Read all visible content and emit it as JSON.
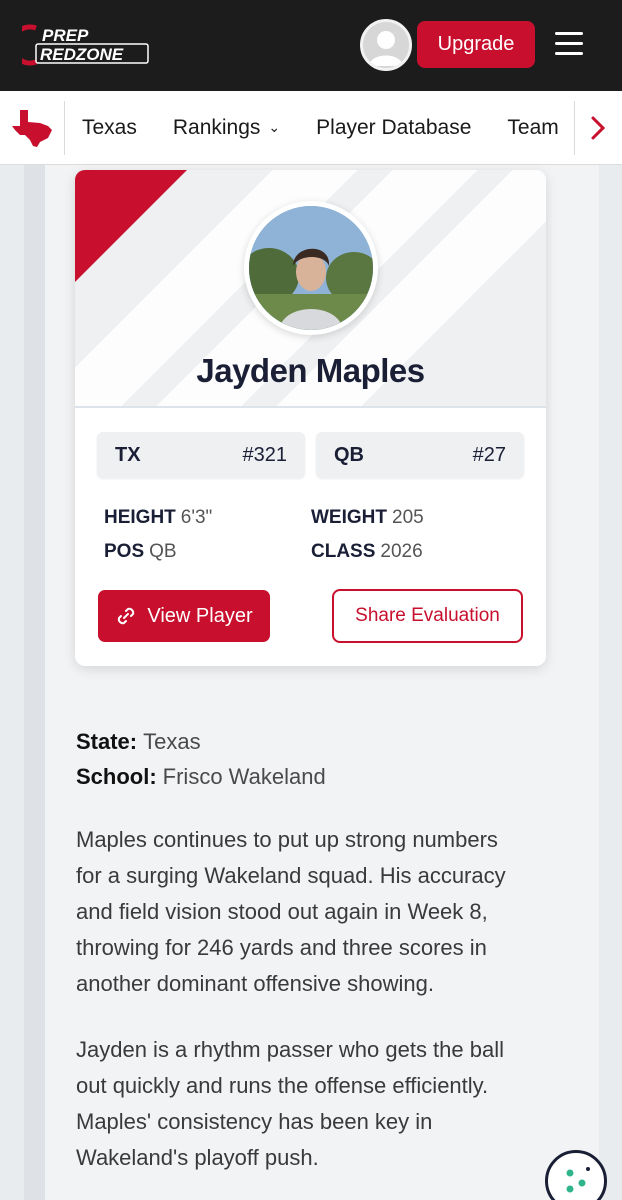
{
  "header": {
    "logo_line1": "PREP",
    "logo_line2": "REDZONE",
    "upgrade_label": "Upgrade",
    "brand_color": "#c8102e",
    "icons": [
      "user-avatar-icon",
      "hamburger-menu-icon"
    ]
  },
  "nav": {
    "state_icon": "texas-map-icon",
    "items": [
      {
        "label": "Texas"
      },
      {
        "label": "Rankings",
        "has_dropdown": true
      },
      {
        "label": "Player Database"
      },
      {
        "label": "Team"
      }
    ],
    "next_icon": "chevron-right-icon"
  },
  "card": {
    "player_name": "Jayden Maples",
    "pills": [
      {
        "key": "TX",
        "value": "#321"
      },
      {
        "key": "QB",
        "value": "#27"
      }
    ],
    "attributes": {
      "height_label": "HEIGHT",
      "height_value": "6'3\"",
      "weight_label": "WEIGHT",
      "weight_value": "205",
      "pos_label": "POS",
      "pos_value": "QB",
      "class_label": "CLASS",
      "class_value": "2026"
    },
    "view_player_label": "View Player",
    "share_label": "Share Evaluation"
  },
  "article": {
    "state_label": "State:",
    "state_value": "Texas",
    "school_label": "School:",
    "school_value": "Frisco Wakeland",
    "para1_lines": [
      "Maples continues to put up strong numbers",
      "for a surging Wakeland squad. His accuracy",
      "and field vision stood out again in Week 8,",
      "throwing for 246 yards and three scores in",
      "another dominant offensive showing."
    ],
    "para2_lines": [
      "Jayden is a rhythm passer who gets the ball",
      "out quickly and runs the offense efficiently.",
      "Maples' consistency has been key in",
      "Wakeland's playoff push."
    ]
  },
  "cookie_icon": "cookie-icon"
}
